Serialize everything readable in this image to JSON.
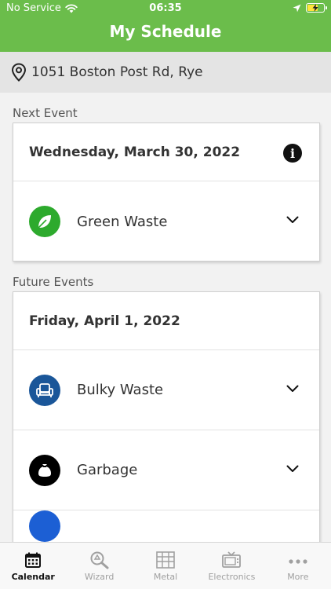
{
  "status_bar": {
    "carrier": "No Service",
    "time": "06:35",
    "battery_level": 0.7
  },
  "header": {
    "title": "My Schedule"
  },
  "address": {
    "label": "1051 Boston Post Rd, Rye"
  },
  "next_event": {
    "section_label": "Next Event",
    "date": "Wednesday, March 30, 2022",
    "events": [
      {
        "name": "Green Waste",
        "icon": "leaf-icon",
        "color": "#2daa2d"
      }
    ]
  },
  "future_events": {
    "section_label": "Future Events",
    "date": "Friday, April 1, 2022",
    "events": [
      {
        "name": "Bulky Waste",
        "icon": "armchair-icon",
        "color": "#1a5699"
      },
      {
        "name": "Garbage",
        "icon": "garbage-bag-icon",
        "color": "#000000"
      },
      {
        "name": "",
        "icon": "recycling-icon",
        "color": "#1c5fd4"
      }
    ]
  },
  "tabbar": {
    "tabs": [
      {
        "label": "Calendar",
        "icon": "calendar-icon",
        "active": true
      },
      {
        "label": "Wizard",
        "icon": "magnifier-recycle-icon",
        "active": false
      },
      {
        "label": "Metal",
        "icon": "metal-icon",
        "active": false
      },
      {
        "label": "Electronics",
        "icon": "tv-icon",
        "active": false
      },
      {
        "label": "More",
        "icon": "more-dots-icon",
        "active": false
      }
    ]
  },
  "colors": {
    "brand_green": "#6bbd4b",
    "address_bg": "#e4e4e4"
  }
}
